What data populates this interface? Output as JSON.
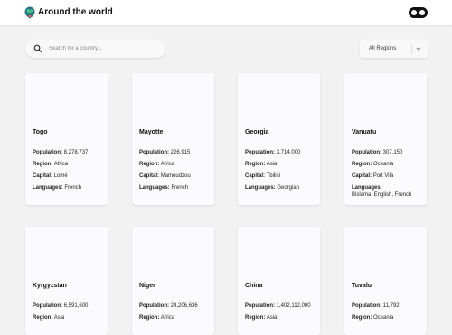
{
  "header": {
    "title": "Around the world",
    "logo_icon": "globe-icon",
    "toggle_icon": "theme-toggle-icon"
  },
  "search": {
    "placeholder": "Search for a country..."
  },
  "filter": {
    "selected": "All Regions"
  },
  "labels": {
    "population": "Population:",
    "region": "Region:",
    "capital": "Capital:",
    "languages": "Languages:"
  },
  "countries": [
    {
      "name": "Togo",
      "population": "8,278,737",
      "region": "Africa",
      "capital": "Lomé",
      "languages": "French"
    },
    {
      "name": "Mayotte",
      "population": "226,915",
      "region": "Africa",
      "capital": "Mamoudzou",
      "languages": "French"
    },
    {
      "name": "Georgia",
      "population": "3,714,000",
      "region": "Asia",
      "capital": "Tbilisi",
      "languages": "Georgian"
    },
    {
      "name": "Vanuatu",
      "population": "307,150",
      "region": "Oceania",
      "capital": "Port Vila",
      "languages": "Bislama, English, French"
    },
    {
      "name": "Kyrgyzstan",
      "population": "6,591,600",
      "region": "Asia"
    },
    {
      "name": "Niger",
      "population": "24,206,636",
      "region": "Africa"
    },
    {
      "name": "China",
      "population": "1,402,112,000",
      "region": "Asia"
    },
    {
      "name": "Tuvalu",
      "population": "11,792",
      "region": "Oceania"
    }
  ]
}
